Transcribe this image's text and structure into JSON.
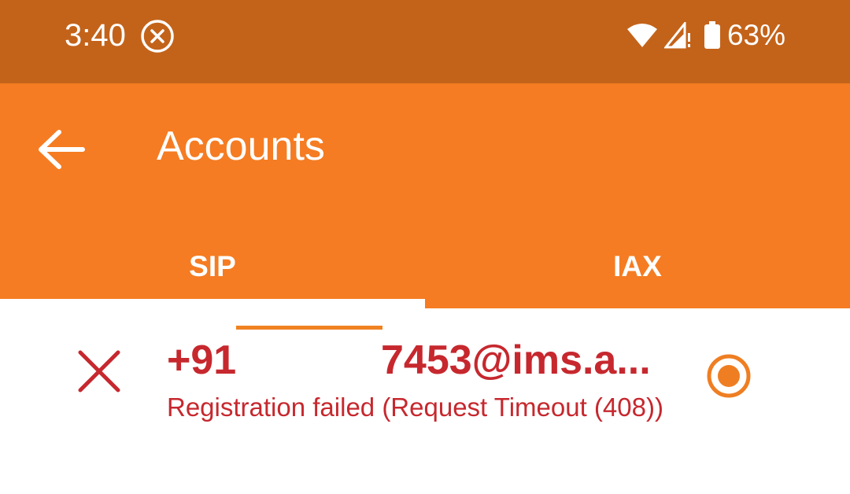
{
  "status_bar": {
    "time": "3:40",
    "battery_percent": "63%",
    "icons": [
      "do-not-disturb-icon",
      "wifi-icon",
      "cell-signal-icon",
      "battery-icon"
    ]
  },
  "app_bar": {
    "title": "Accounts",
    "back_icon": "arrow-back-icon"
  },
  "tabs": [
    {
      "label": "SIP",
      "selected": true
    },
    {
      "label": "IAX",
      "selected": false
    }
  ],
  "accounts": [
    {
      "name_prefix": "+91",
      "name_suffix": "7453@ims.a...",
      "status": "Registration failed (Request Timeout (408))",
      "status_icon": "close-icon",
      "default_selected": true
    }
  ],
  "colors": {
    "status_bar": "#C3631A",
    "app_bar": "#F57C22",
    "error": "#C6282E",
    "radio_accent": "#EF7E22"
  }
}
